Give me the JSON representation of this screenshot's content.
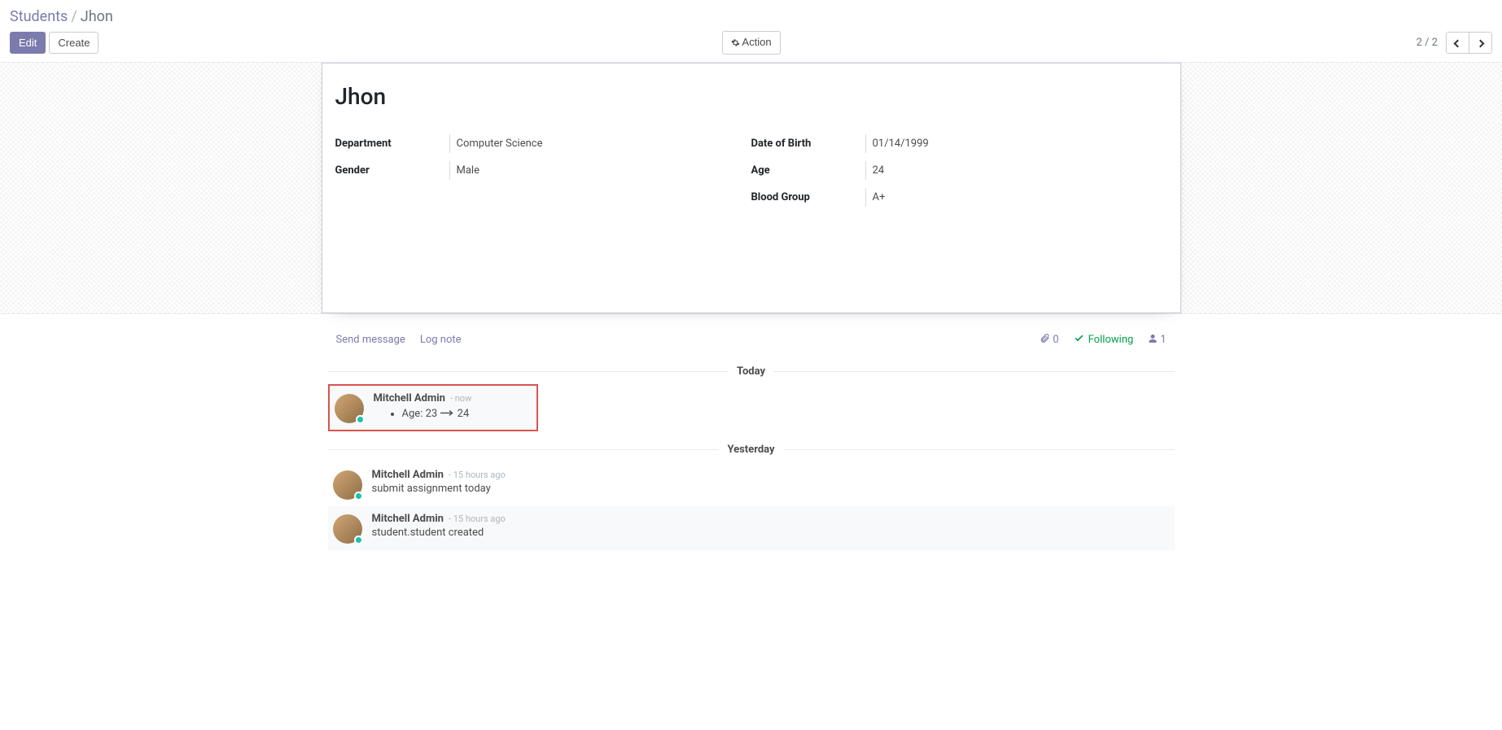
{
  "breadcrumb": {
    "parent": "Students",
    "current": "Jhon"
  },
  "buttons": {
    "edit": "Edit",
    "create": "Create",
    "action": "Action"
  },
  "pager": {
    "text": "2 / 2"
  },
  "form": {
    "title": "Jhon",
    "left": [
      {
        "label": "Department",
        "value": "Computer Science"
      },
      {
        "label": "Gender",
        "value": "Male"
      }
    ],
    "right": [
      {
        "label": "Date of Birth",
        "value": "01/14/1999"
      },
      {
        "label": "Age",
        "value": "24"
      },
      {
        "label": "Blood Group",
        "value": "A+"
      }
    ]
  },
  "chatter": {
    "send_message": "Send message",
    "log_note": "Log note",
    "attachments": "0",
    "following": "Following",
    "followers": "1",
    "sections": {
      "today": "Today",
      "yesterday": "Yesterday"
    },
    "messages": {
      "m0": {
        "author": "Mitchell Admin",
        "time": "- now",
        "change_label": "Age:",
        "change_from": "23",
        "change_to": "24"
      },
      "m1": {
        "author": "Mitchell Admin",
        "time": "- 15 hours ago",
        "content": "submit assignment today"
      },
      "m2": {
        "author": "Mitchell Admin",
        "time": "- 15 hours ago",
        "content": "student.student created"
      }
    }
  }
}
